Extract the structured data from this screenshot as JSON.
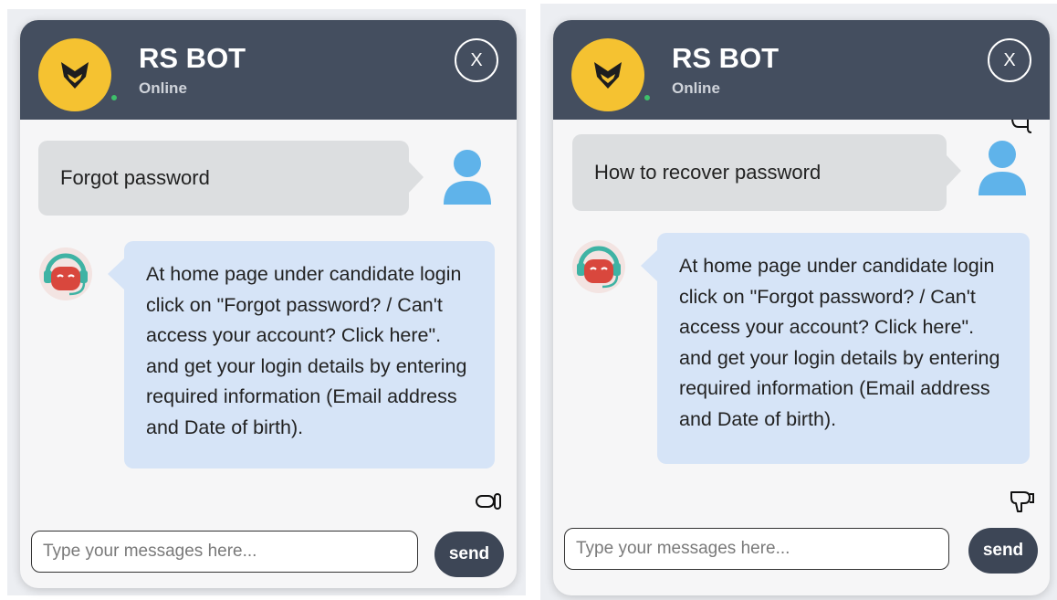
{
  "left_widget": {
    "bot_name": "RS BOT",
    "status": "Online",
    "close_label": "X",
    "user_message": "Forgot password",
    "bot_reply": "At home page under candidate login click on \"Forgot password? / Can't access your account? Click here\". and get your login details by entering required information (Email address and Date of birth).",
    "input_placeholder": "Type your messages here...",
    "send_label": "send"
  },
  "right_widget": {
    "bot_name": "RS BOT",
    "status": "Online",
    "close_label": "X",
    "user_message": "How to recover password",
    "bot_reply": "At home page under candidate login click on \"Forgot password? / Can't access your account? Click here\". and get your login details by entering required information (Email address and Date of birth).",
    "input_placeholder": "Type your messages here...",
    "send_label": "send"
  },
  "colors": {
    "header_bg": "#444e5f",
    "logo_bg": "#f5c231",
    "online_dot": "#3ec06b",
    "user_bubble": "#dcdee0",
    "bot_bubble": "#d6e4f7",
    "send_button": "#3d4656",
    "user_avatar": "#5fb3ea",
    "bot_avatar_red": "#d9473d",
    "bot_headset": "#3fb3a4"
  },
  "icons": {
    "logo": "fox-logo-icon",
    "close": "close-icon",
    "user": "user-avatar-icon",
    "bot": "bot-avatar-icon",
    "feedback_left": "thumbs-down-outline-icon",
    "feedback_right": "thumbs-down-icon"
  }
}
